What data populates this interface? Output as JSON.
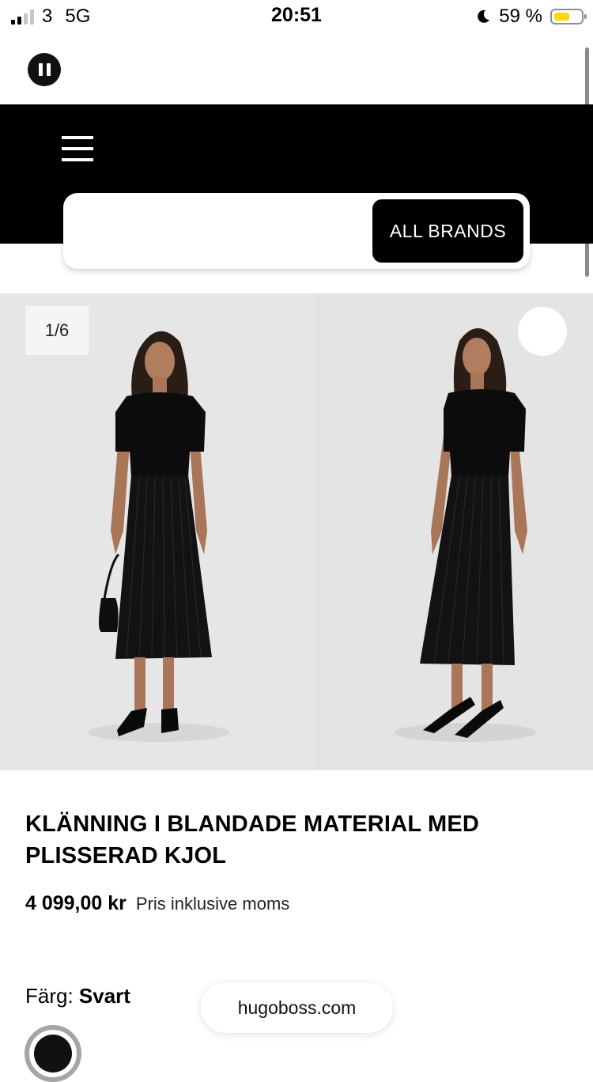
{
  "status_bar": {
    "carrier": "3",
    "network": "5G",
    "time": "20:51",
    "battery": "59 %",
    "battery_level": 0.59,
    "battery_color": "#ffd60a"
  },
  "header": {
    "brands_button": "ALL BRANDS"
  },
  "gallery": {
    "counter": "1/6"
  },
  "product": {
    "title_line1": "KLÄNNING I BLANDADE MATERIAL MED",
    "title_line2": "PLISSERAD KJOL",
    "price": "4 099,00 kr",
    "price_note": "Pris inklusive moms",
    "color_label": "Färg:",
    "color_value": "Svart",
    "swatch_color": "#111111"
  },
  "browser": {
    "url": "hugoboss.com"
  }
}
